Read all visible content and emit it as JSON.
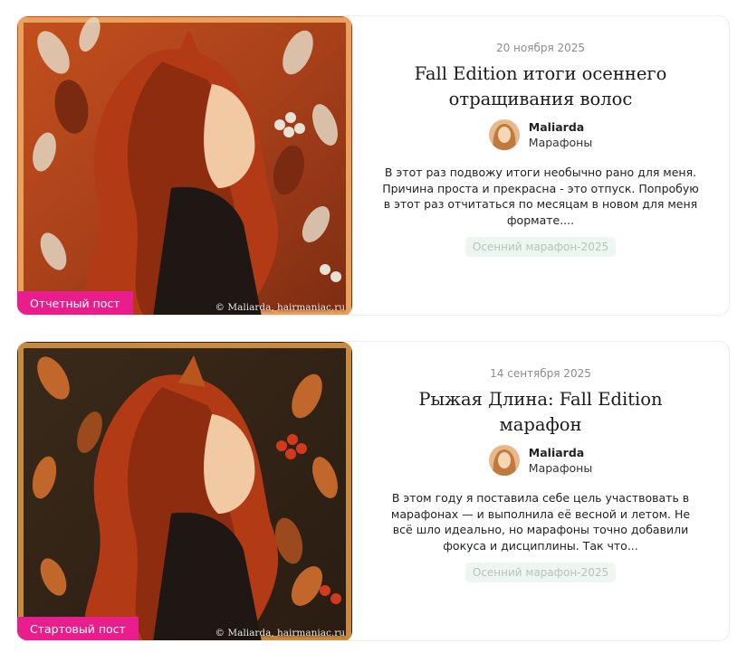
{
  "posts": [
    {
      "badge": "Отчетный пост",
      "credit": "© Maliarda, hairmaniac.ru",
      "date": "20 ноября 2025",
      "title": "Fall Edition итоги осеннего отращивания волос",
      "author": "Maliarda",
      "category": "Марафоны",
      "excerpt": "В этот раз подвожу итоги необычно рано для меня. Причина проста и прекрасна - это отпуск. Попробую в этот раз отчитаться по месяцам в новом для меня формате....",
      "tag": "Осенний марафон-2025",
      "image_icon": "red-haired-woman-fox-ears-illustration"
    },
    {
      "badge": "Стартовый пост",
      "credit": "© Maliarda, hairmaniac.ru",
      "date": "14 сентября 2025",
      "title": "Рыжая Длина: Fall Edition марафон",
      "author": "Maliarda",
      "category": "Марафоны",
      "excerpt": "В этом году я поставила себе цель участвовать в марафонах — и выполнила её весной и летом. Не всё шло идеально, но марафоны точно добавили фокуса и дисциплины. Так что...",
      "tag": "Осенний марафон-2025",
      "image_icon": "red-haired-woman-fox-ears-illustration"
    }
  ],
  "colors": {
    "badge": "#e91e8c",
    "tag_bg": "#eef6f1",
    "tag_text": "#b5c5bb",
    "date": "#8c8c8c"
  }
}
